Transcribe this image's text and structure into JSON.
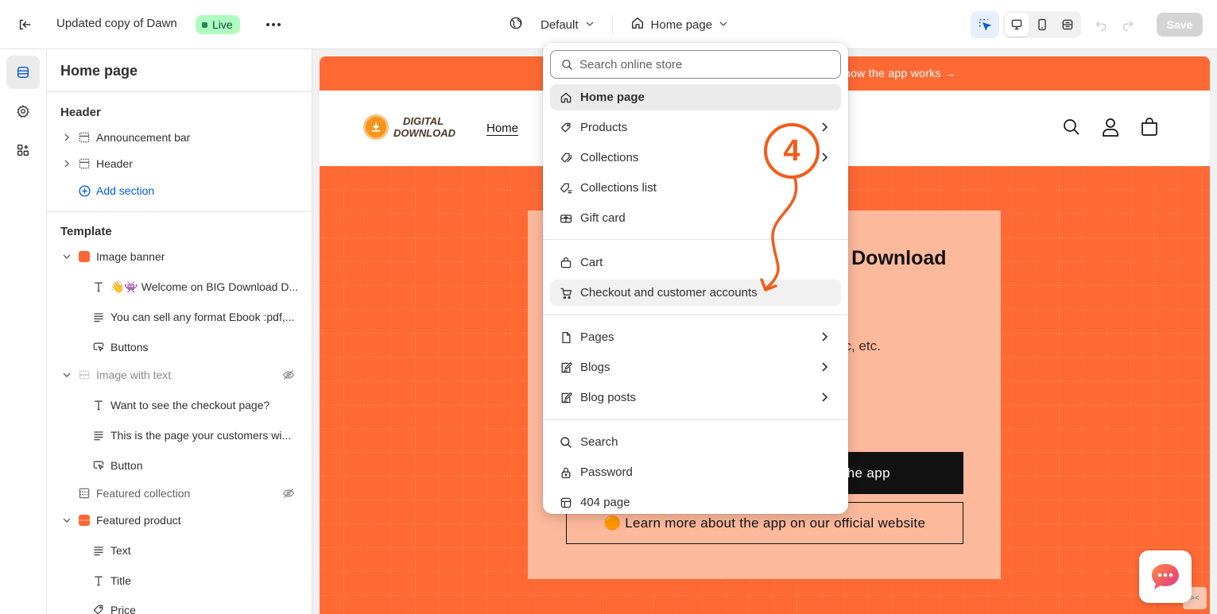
{
  "topbar": {
    "theme_name": "Updated copy of Dawn",
    "status_badge": "Live",
    "more_label": "•••",
    "view_selector": "Default",
    "page_selector": "Home page",
    "save_label": "Save"
  },
  "sidebar": {
    "title": "Home page",
    "header_group": "Header",
    "header_items": [
      {
        "label": "Announcement bar"
      },
      {
        "label": "Header"
      }
    ],
    "add_section": "Add section",
    "template_group": "Template",
    "template_items": [
      {
        "label": "Image banner"
      },
      {
        "label": "👋👾 Welcome on BIG Download D..."
      },
      {
        "label": "You can sell any format Ebook :pdf,..."
      },
      {
        "label": "Buttons"
      },
      {
        "label": "Image with text"
      },
      {
        "label": "Want to see the checkout page?"
      },
      {
        "label": "This is the page your customers wi..."
      },
      {
        "label": "Button"
      },
      {
        "label": "Featured collection"
      },
      {
        "label": "Featured product"
      },
      {
        "label": "Text"
      },
      {
        "label": "Title"
      },
      {
        "label": "Price"
      }
    ]
  },
  "preview": {
    "announcement": "how the app works →",
    "logo_line1": "DIGITAL",
    "logo_line2": "DOWNLOAD",
    "nav_home": "Home",
    "hero_title": "ad Download",
    "hero_line1": "nc, etc.",
    "hero_line2": "c.",
    "primary_button": "est the app",
    "secondary_button": "🟠 Learn more about the app on our official website",
    "edge_handle": "><"
  },
  "dropdown": {
    "search_placeholder": "Search online store",
    "items": [
      {
        "label": "Home page",
        "icon": "home-icon"
      },
      {
        "label": "Products",
        "icon": "tag-icon"
      },
      {
        "label": "Collections",
        "icon": "collection-icon"
      },
      {
        "label": "Collections list",
        "icon": "collections-list-icon"
      },
      {
        "label": "Gift card",
        "icon": "gift-card-icon"
      },
      {
        "label": "Cart",
        "icon": "bag-icon"
      },
      {
        "label": "Checkout and customer accounts",
        "icon": "cart-icon"
      },
      {
        "label": "Pages",
        "icon": "page-icon"
      },
      {
        "label": "Blogs",
        "icon": "blog-icon"
      },
      {
        "label": "Blog posts",
        "icon": "blog-post-icon"
      },
      {
        "label": "Search",
        "icon": "search-icon"
      },
      {
        "label": "Password",
        "icon": "lock-icon"
      },
      {
        "label": "404 page",
        "icon": "404-icon"
      }
    ]
  },
  "annotation": {
    "step_number": "4",
    "color": "#f25c19"
  },
  "colors": {
    "accent": "#ff6a34",
    "link": "#005bd3",
    "live_badge_bg": "#affebf"
  }
}
